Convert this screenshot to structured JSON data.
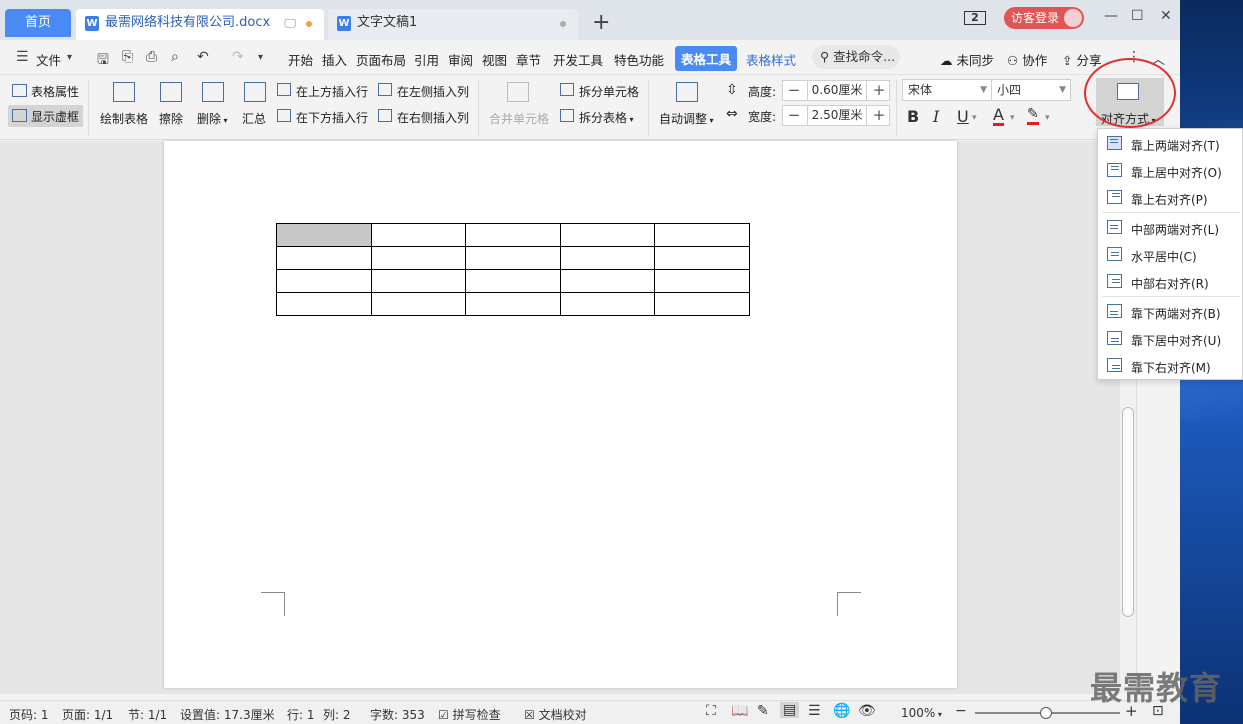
{
  "tabs": {
    "home": "首页",
    "active_doc": "最需网络科技有限公司.docx",
    "inactive_doc": "文字文稿1",
    "new_tab": "+"
  },
  "titlebar": {
    "badge": "2",
    "login": "访客登录",
    "minimize": "—",
    "maximize": "☐",
    "close": "✕"
  },
  "menubar": {
    "file": "文件",
    "items": [
      "开始",
      "插入",
      "页面布局",
      "引用",
      "审阅",
      "视图",
      "章节",
      "开发工具",
      "特色功能"
    ],
    "table_tools": "表格工具",
    "table_style": "表格样式",
    "search": "查找命令...",
    "sync": "未同步",
    "collab": "协作",
    "share": "分享"
  },
  "ribbon": {
    "table_props": "表格属性",
    "show_grid": "显示虚框",
    "draw_table": "绘制表格",
    "erase": "擦除",
    "delete": "删除",
    "summary": "汇总",
    "insert_above": "在上方插入行",
    "insert_below": "在下方插入行",
    "insert_left": "在左侧插入列",
    "insert_right": "在右侧插入列",
    "merge_cells": "合并单元格",
    "split_cells": "拆分单元格",
    "split_table": "拆分表格",
    "auto_fit": "自动调整",
    "height_label": "高度:",
    "height_value": "0.60厘米",
    "width_label": "宽度:",
    "width_value": "2.50厘米",
    "font_name": "宋体",
    "font_size": "小四",
    "bold": "B",
    "italic": "I",
    "underline": "U",
    "font_color": "A",
    "align_button": "对齐方式"
  },
  "align_menu": [
    "靠上两端对齐(T)",
    "靠上居中对齐(O)",
    "靠上右对齐(P)",
    "中部两端对齐(L)",
    "水平居中(C)",
    "中部右对齐(R)",
    "靠下两端对齐(B)",
    "靠下居中对齐(U)",
    "靠下右对齐(M)"
  ],
  "status": {
    "page_num": "页码: 1",
    "pages": "页面: 1/1",
    "section": "节: 1/1",
    "setting": "设置值: 17.3厘米",
    "row": "行: 1",
    "col": "列: 2",
    "words": "字数: 353",
    "spell": "拼写检查",
    "proof": "文档校对",
    "zoom": "100%"
  },
  "watermark": "最需教育",
  "colors": {
    "accent": "#4a8af4",
    "login": "#e05555",
    "highlight_circle": "#e23030"
  }
}
